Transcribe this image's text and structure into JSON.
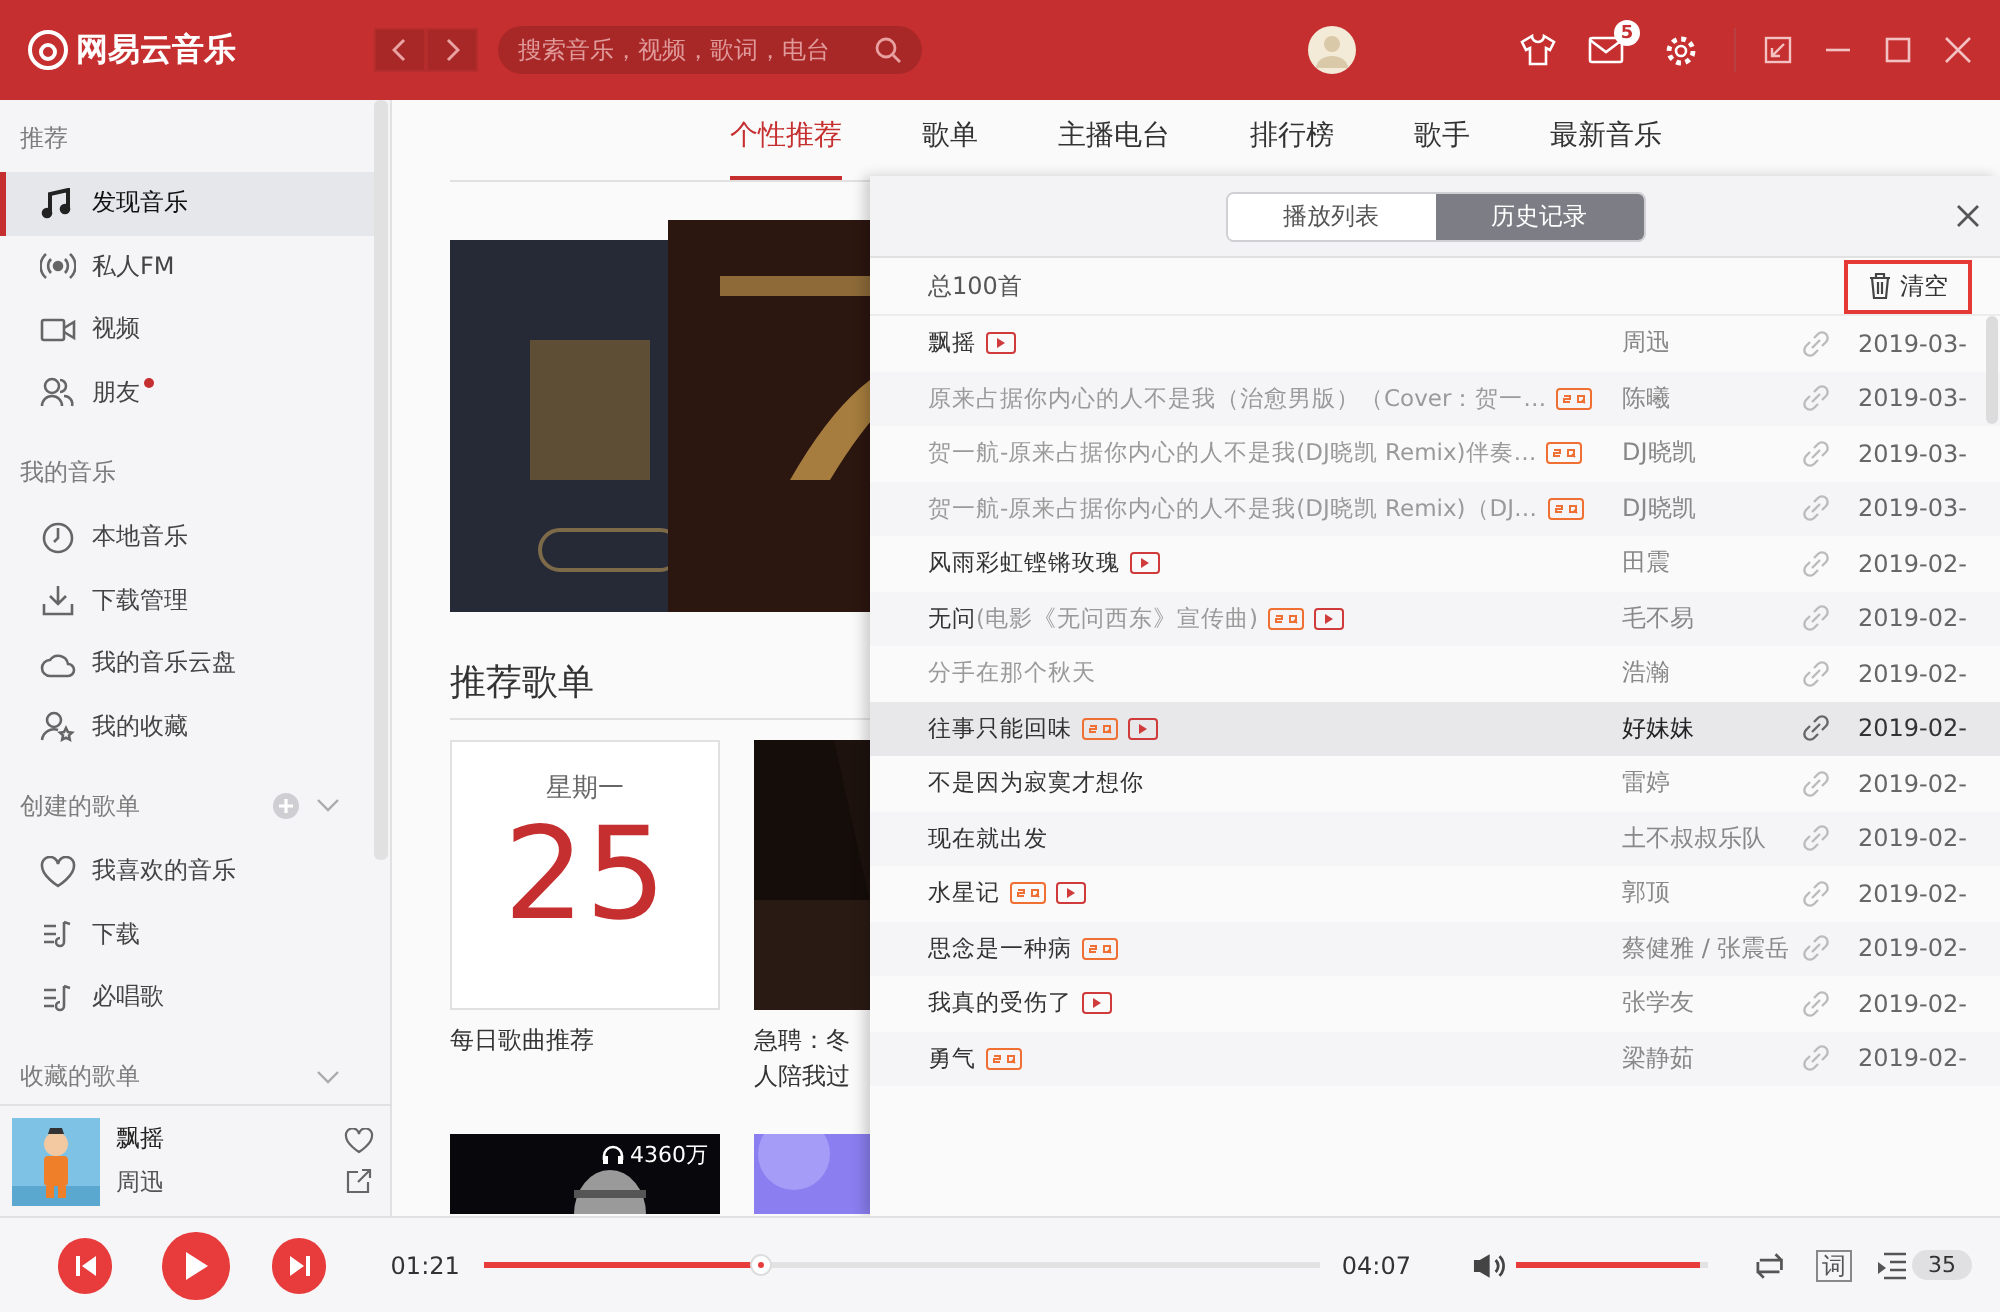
{
  "app": {
    "logo": "网易云音乐",
    "search": {
      "placeholder": "搜索音乐，视频，歌词，电台"
    },
    "mail_badge": "5"
  },
  "sidebar": {
    "sections": [
      {
        "title": "推荐",
        "add": false,
        "collapsible": false,
        "items": [
          {
            "label": "发现音乐",
            "kind": "music",
            "selected": true,
            "dot": false
          },
          {
            "label": "私人FM",
            "kind": "radio",
            "selected": false,
            "dot": false
          },
          {
            "label": "视频",
            "kind": "video",
            "selected": false,
            "dot": false
          },
          {
            "label": "朋友",
            "kind": "friends",
            "selected": false,
            "dot": true
          }
        ]
      },
      {
        "title": "我的音乐",
        "add": false,
        "collapsible": false,
        "items": [
          {
            "label": "本地音乐",
            "kind": "local",
            "selected": false,
            "dot": false
          },
          {
            "label": "下载管理",
            "kind": "download",
            "selected": false,
            "dot": false
          },
          {
            "label": "我的音乐云盘",
            "kind": "cloud",
            "selected": false,
            "dot": false
          },
          {
            "label": "我的收藏",
            "kind": "collection",
            "selected": false,
            "dot": false
          }
        ]
      },
      {
        "title": "创建的歌单",
        "add": true,
        "collapsible": true,
        "items": [
          {
            "label": "我喜欢的音乐",
            "kind": "heart",
            "selected": false,
            "dot": false
          },
          {
            "label": "下载",
            "kind": "playlist",
            "selected": false,
            "dot": false
          },
          {
            "label": "必唱歌",
            "kind": "playlist",
            "selected": false,
            "dot": false
          }
        ]
      },
      {
        "title": "收藏的歌单",
        "add": false,
        "collapsible": true
      }
    ],
    "now_playing": {
      "title": "飘摇",
      "artist": "周迅"
    }
  },
  "tabs": [
    {
      "label": "个性推荐",
      "selected": true
    },
    {
      "label": "歌单",
      "selected": false
    },
    {
      "label": "主播电台",
      "selected": false
    },
    {
      "label": "排行榜",
      "selected": false
    },
    {
      "label": "歌手",
      "selected": false
    },
    {
      "label": "最新音乐",
      "selected": false
    }
  ],
  "section_title": "推荐歌单",
  "daily_card": {
    "weekday": "星期一",
    "day": "25",
    "caption": "每日歌曲推荐"
  },
  "second_card": {
    "caption_lines": [
      "急聘：冬",
      "人陪我过"
    ]
  },
  "play_count": "4360万",
  "panel": {
    "tabs": [
      {
        "label": "播放列表",
        "selected": false
      },
      {
        "label": "历史记录",
        "selected": true
      }
    ],
    "total": "总100首",
    "clear": {
      "label": "清空",
      "highlighted": true
    },
    "rows": [
      {
        "title": "飘摇",
        "sq": false,
        "mv": true,
        "artist": "周迅",
        "date": "2019-03-",
        "disabled": false,
        "selected": false
      },
      {
        "title": "原来占据你内心的人不是我（治愈男版）（Cover：贺一…",
        "sq": true,
        "mv": false,
        "artist": "陈曦",
        "date": "2019-03-",
        "disabled": true,
        "selected": false
      },
      {
        "title": "贺一航-原来占据你内心的人不是我(DJ晓凯 Remix)伴奏…",
        "sq": true,
        "mv": false,
        "artist": "DJ晓凯",
        "date": "2019-03-",
        "disabled": true,
        "selected": false
      },
      {
        "title": "贺一航-原来占据你内心的人不是我(DJ晓凯 Remix)（DJ…",
        "sq": true,
        "mv": false,
        "artist": "DJ晓凯",
        "date": "2019-03-",
        "disabled": true,
        "selected": false
      },
      {
        "title": "风雨彩虹铿锵玫瑰",
        "sq": false,
        "mv": true,
        "artist": "田震",
        "date": "2019-02-",
        "disabled": false,
        "selected": false
      },
      {
        "title": "无问",
        "subtitle": "(电影《无问西东》宣传曲)",
        "sq": true,
        "mv": true,
        "artist": "毛不易",
        "date": "2019-02-",
        "disabled": false,
        "selected": false
      },
      {
        "title": "分手在那个秋天",
        "sq": false,
        "mv": false,
        "artist": "浩瀚",
        "date": "2019-02-",
        "disabled": true,
        "selected": false
      },
      {
        "title": "往事只能回味",
        "sq": true,
        "mv": true,
        "artist": "好妹妹",
        "date": "2019-02-",
        "disabled": false,
        "selected": true
      },
      {
        "title": "不是因为寂寞才想你",
        "sq": false,
        "mv": false,
        "artist": "雷婷",
        "date": "2019-02-",
        "disabled": false,
        "selected": false
      },
      {
        "title": "现在就出发",
        "sq": false,
        "mv": false,
        "artist": "土不叔叔乐队",
        "date": "2019-02-",
        "disabled": false,
        "selected": false
      },
      {
        "title": "水星记",
        "sq": true,
        "mv": true,
        "artist": "郭顶",
        "date": "2019-02-",
        "disabled": false,
        "selected": false
      },
      {
        "title": "思念是一种病",
        "sq": true,
        "mv": false,
        "artist": "蔡健雅 / 张震岳",
        "date": "2019-02-",
        "disabled": false,
        "selected": false
      },
      {
        "title": "我真的受伤了",
        "sq": false,
        "mv": true,
        "artist": "张学友",
        "date": "2019-02-",
        "disabled": false,
        "selected": false
      },
      {
        "title": "勇气",
        "sq": true,
        "mv": false,
        "artist": "梁静茹",
        "date": "2019-02-",
        "disabled": false,
        "selected": false
      }
    ]
  },
  "player": {
    "elapsed": "01:21",
    "duration": "04:07",
    "progress": {
      "level": 0.33
    },
    "volume": {
      "level": 0.95
    },
    "lyrics": "词",
    "queue_count": "35"
  }
}
